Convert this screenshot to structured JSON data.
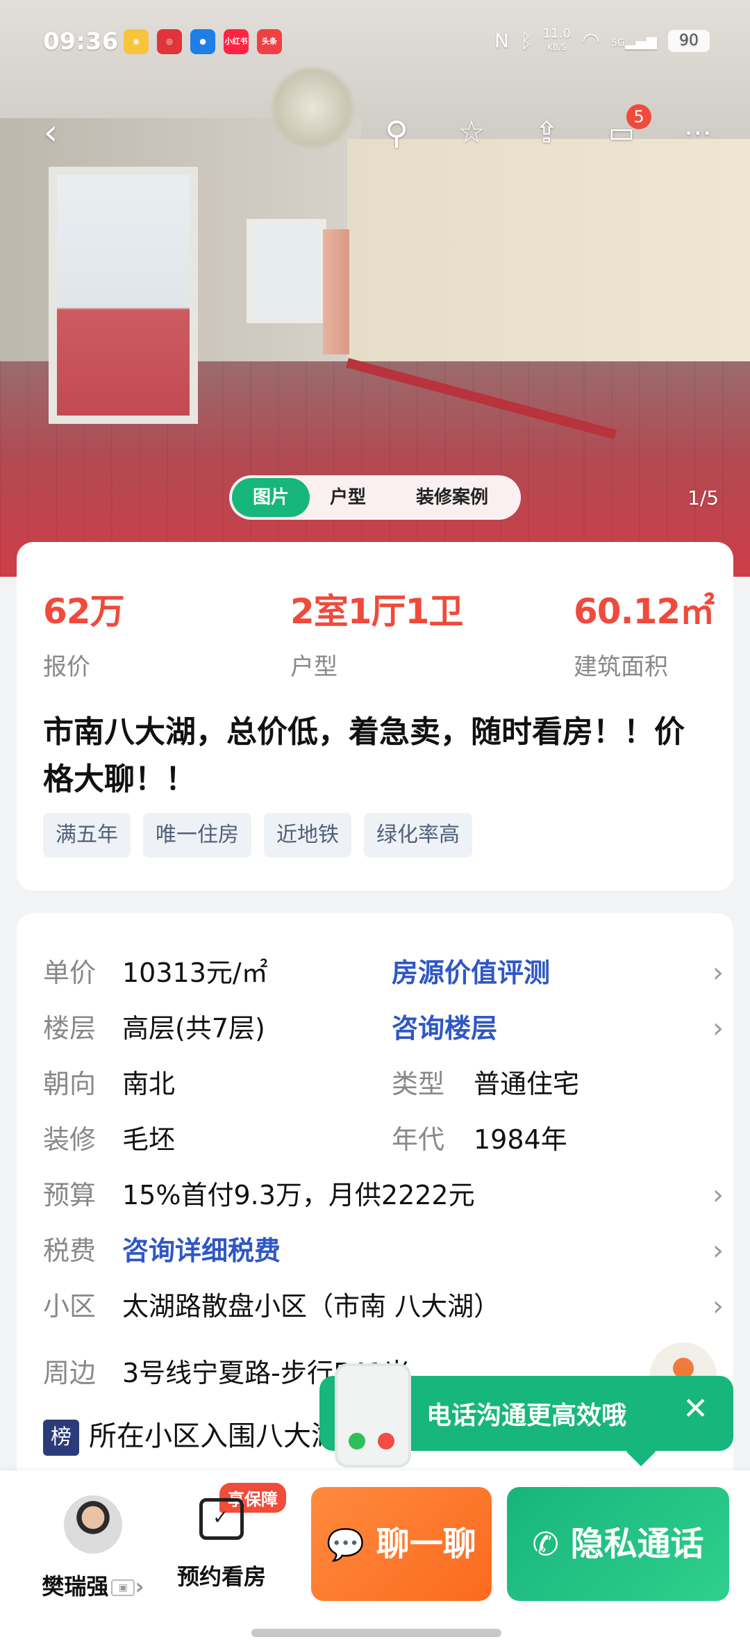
{
  "status_bar": {
    "time": "09:36",
    "net_speed": "11.0",
    "net_unit": "KB/S",
    "network": "5G",
    "battery": "90",
    "apps": [
      "weibo",
      "app2",
      "app3",
      "小红书",
      "头条"
    ]
  },
  "nav": {
    "back_icon": "back-arrow-icon",
    "message_badge": "5"
  },
  "gallery": {
    "tabs": [
      "图片",
      "户型",
      "装修案例"
    ],
    "pager": "1/5"
  },
  "summary": {
    "price_value": "62万",
    "price_label": "报价",
    "layout_value": "2室1厅1卫",
    "layout_label": "户型",
    "area_value": "60.12㎡",
    "area_label": "建筑面积",
    "title": "市南八大湖，总价低，着急卖，随时看房！！价格大聊！！",
    "tags": [
      "满五年",
      "唯一住房",
      "近地铁",
      "绿化率高"
    ]
  },
  "details": {
    "unit_price_label": "单价",
    "unit_price_value": "10313元/㎡",
    "value_eval": "房源价值评测",
    "floor_label": "楼层",
    "floor_value": "高层(共7层)",
    "consult_floor": "咨询楼层",
    "orientation_label": "朝向",
    "orientation_value": "南北",
    "type_label": "类型",
    "type_value": "普通住宅",
    "decor_label": "装修",
    "decor_value": "毛坯",
    "year_label": "年代",
    "year_value": "1984年",
    "budget_label": "预算",
    "budget_value": "15%首付9.3万，月供2222元",
    "tax_label": "税费",
    "tax_value": "咨询详细税费",
    "community_label": "小区",
    "community_value": "太湖路散盘小区（市南 八大湖）",
    "nearby_label": "周边",
    "nearby_value": "3号线宁夏路-步行541米",
    "rank_badge": "榜",
    "rank_text": "所在小区入围八大湖人气榜"
  },
  "tip": {
    "text": "电话沟通更高效哦",
    "close": "✕"
  },
  "bottom": {
    "agent_name": "樊瑞强",
    "appointment": "预约看房",
    "guarantee": "享保障",
    "chat": "聊一聊",
    "call": "隐私通话"
  },
  "colors": {
    "accent_red": "#ef4a3b",
    "accent_green": "#17b67c",
    "accent_orange": "#fb6a1e",
    "link_blue": "#2f57c4"
  }
}
